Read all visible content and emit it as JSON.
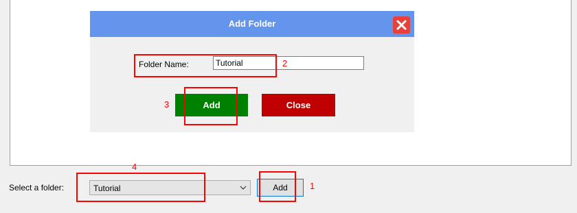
{
  "dialog": {
    "title": "Add Folder",
    "folder_label": "Folder Name:",
    "folder_value": "Tutorial",
    "add_label": "Add",
    "close_label": "Close"
  },
  "bottom_bar": {
    "select_label": "Select a folder:",
    "selected_folder": "Tutorial",
    "add_label": "Add"
  },
  "annotations": [
    "1",
    "2",
    "3",
    "4"
  ],
  "colors": {
    "titlebar": "#6495ed",
    "close_icon_bg": "#e8403a",
    "add_button": "#008000",
    "close_button": "#c00000",
    "annotation": "#ff0000",
    "focus_border": "#0078d7"
  },
  "icons": {
    "close": "close-icon",
    "dropdown": "chevron-down-icon"
  }
}
